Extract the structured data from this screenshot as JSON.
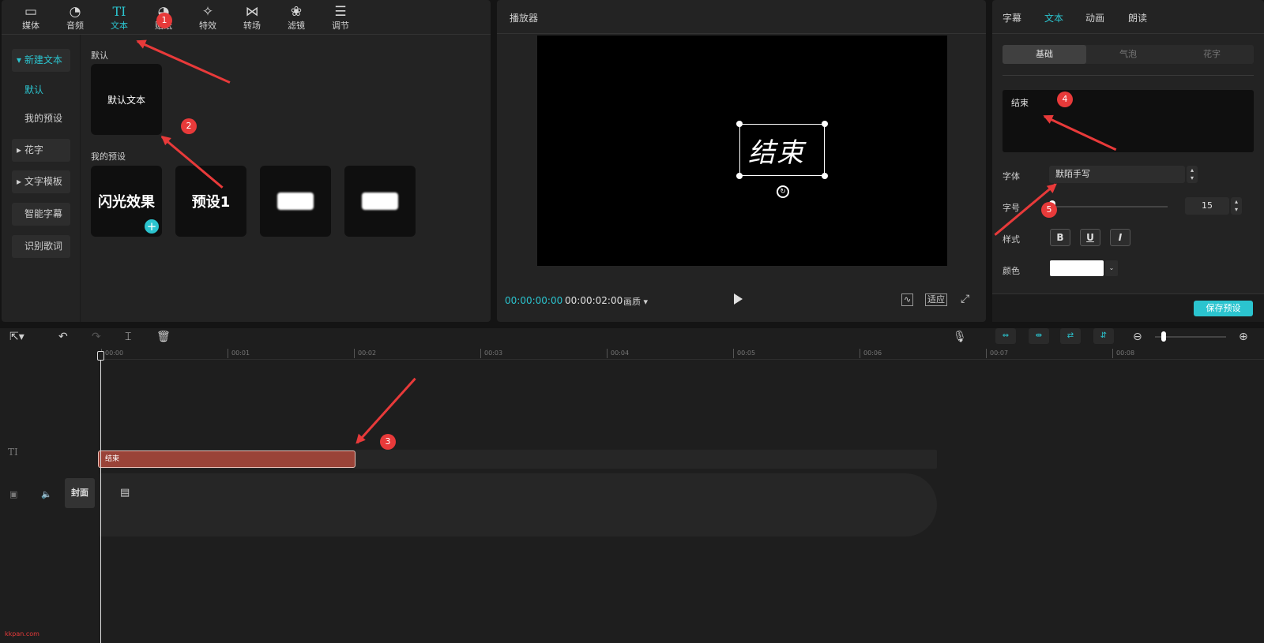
{
  "toolbar": {
    "tabs": [
      {
        "label": "媒体",
        "icon": "media-icon"
      },
      {
        "label": "音频",
        "icon": "audio-icon"
      },
      {
        "label": "文本",
        "icon": "text-icon",
        "active": true
      },
      {
        "label": "贴纸",
        "icon": "sticker-icon"
      },
      {
        "label": "特效",
        "icon": "effect-icon"
      },
      {
        "label": "转场",
        "icon": "transition-icon"
      },
      {
        "label": "滤镜",
        "icon": "filter-icon"
      },
      {
        "label": "调节",
        "icon": "adjust-icon"
      }
    ]
  },
  "sidebar": {
    "items": [
      {
        "label": "新建文本"
      },
      {
        "label": "默认"
      },
      {
        "label": "我的预设"
      },
      {
        "label": "花字"
      },
      {
        "label": "文字模板"
      },
      {
        "label": "智能字幕"
      },
      {
        "label": "识别歌词"
      }
    ]
  },
  "library": {
    "default_title": "默认",
    "default_card": "默认文本",
    "presets_title": "我的预设",
    "preset_cards": [
      "闪光效果",
      "预设1"
    ]
  },
  "annotations": [
    "1",
    "2",
    "3",
    "4",
    "5"
  ],
  "player": {
    "title": "播放器",
    "overlay_text": "结束",
    "current_time": "00:00:00:00",
    "total_time": "00:00:02:00",
    "quality": "画质",
    "fit_label": "适应"
  },
  "properties": {
    "tabs": [
      {
        "label": "字幕"
      },
      {
        "label": "文本",
        "active": true
      },
      {
        "label": "动画"
      },
      {
        "label": "朗读"
      }
    ],
    "segments": [
      "基础",
      "气泡",
      "花字"
    ],
    "text_value": "结束",
    "font_label": "字体",
    "font_value": "默陌手写",
    "size_label": "字号",
    "size_value": "15",
    "size_level": 0.0,
    "style_label": "样式",
    "style_buttons": [
      "B",
      "U",
      "I"
    ],
    "color_label": "颜色",
    "color_value": "#ffffff",
    "save_label": "保存预设"
  },
  "timeline": {
    "ticks": [
      "00:00",
      "00:01",
      "00:02",
      "00:03",
      "00:04",
      "00:05",
      "00:06",
      "00:07",
      "00:08"
    ],
    "clip_label": "结束",
    "cover_label": "封面"
  },
  "colors": {
    "accent": "#2bc4cf",
    "annotation": "#e83a3a",
    "clip": "#9a4338"
  },
  "watermark": "kkpan.com"
}
